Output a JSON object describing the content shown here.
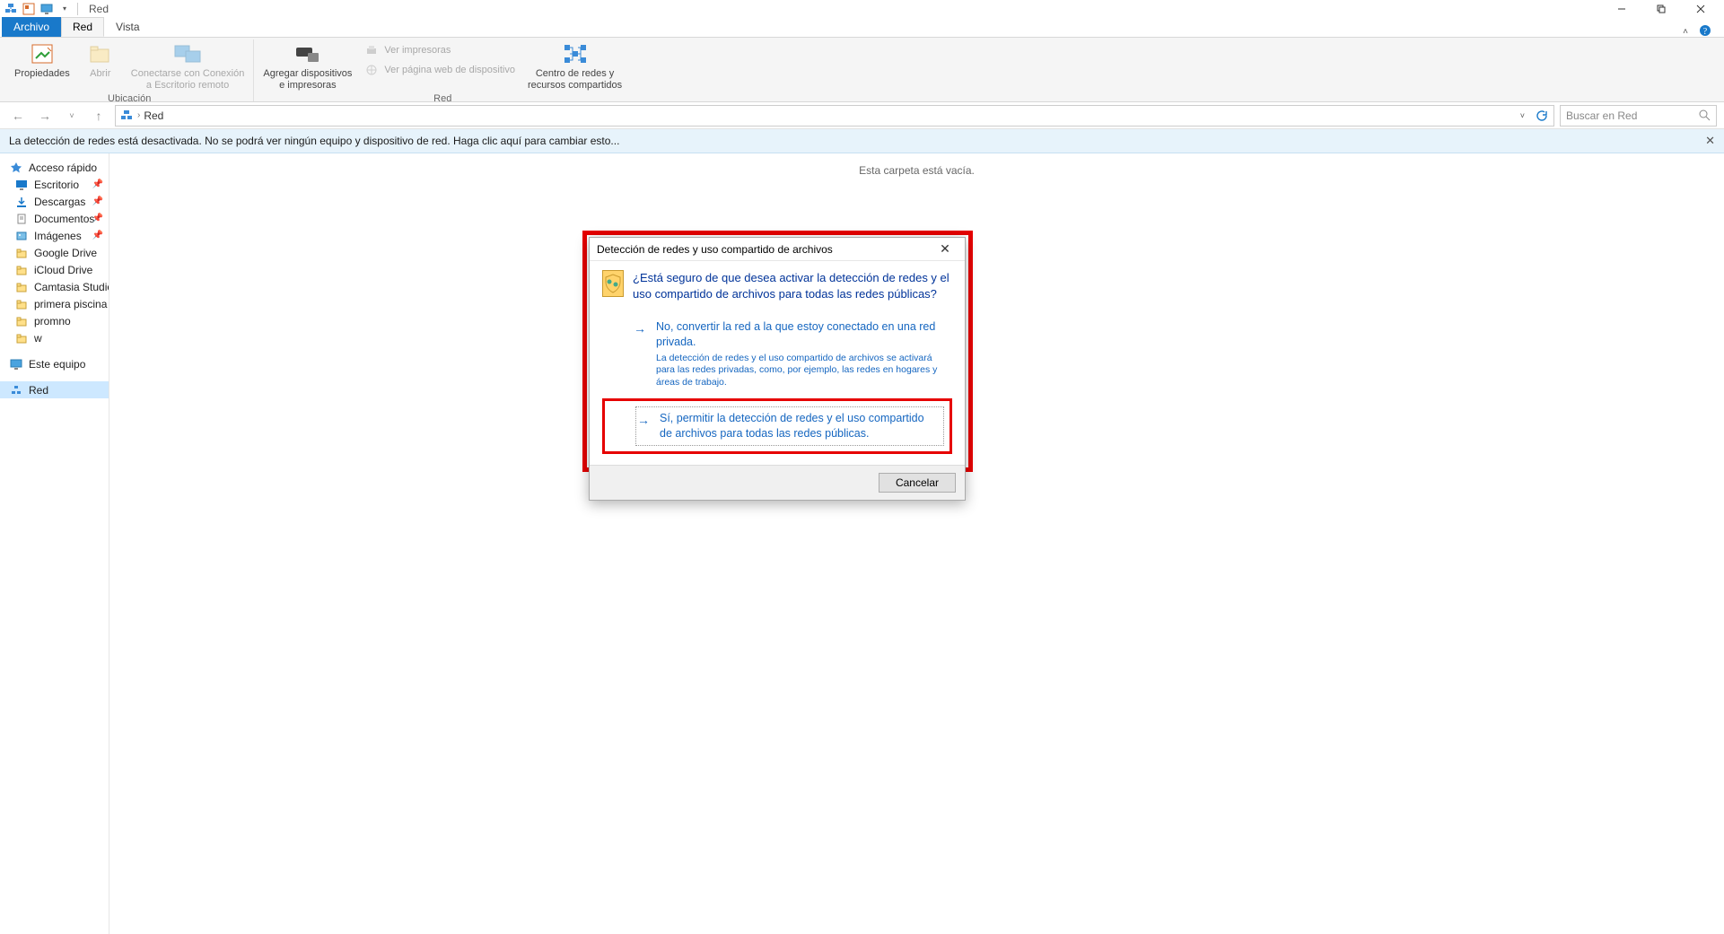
{
  "title": "Red",
  "tabs": [
    "Archivo",
    "Red",
    "Vista"
  ],
  "ribbon": {
    "ubicacion": {
      "group": "Ubicación",
      "propiedades": "Propiedades",
      "abrir": "Abrir",
      "conectarse": "Conectarse con Conexión\na Escritorio remoto"
    },
    "red": {
      "group": "Red",
      "agregar": "Agregar dispositivos\ne impresoras",
      "ver_impresoras": "Ver impresoras",
      "ver_pagina": "Ver página web de dispositivo",
      "centro": "Centro de redes y\nrecursos compartidos"
    }
  },
  "address": {
    "crumb": "Red"
  },
  "search": {
    "placeholder": "Buscar en Red"
  },
  "banner": {
    "text": "La detección de redes está desactivada. No se podrá ver ningún equipo y dispositivo de red. Haga clic aquí para cambiar esto..."
  },
  "sidebar": {
    "quick_access": "Acceso rápido",
    "items": [
      {
        "label": "Escritorio",
        "pinned": true
      },
      {
        "label": "Descargas",
        "pinned": true
      },
      {
        "label": "Documentos",
        "pinned": true
      },
      {
        "label": "Imágenes",
        "pinned": true
      },
      {
        "label": "Google Drive",
        "pinned": false
      },
      {
        "label": "iCloud Drive",
        "pinned": false
      },
      {
        "label": "Camtasia Studio",
        "pinned": false
      },
      {
        "label": "primera piscina",
        "pinned": false
      },
      {
        "label": "promno",
        "pinned": false
      },
      {
        "label": "w",
        "pinned": false
      }
    ],
    "este_equipo": "Este equipo",
    "red": "Red"
  },
  "content": {
    "empty": "Esta carpeta está vacía."
  },
  "dialog": {
    "title": "Detección de redes y uso compartido de archivos",
    "question": "¿Está seguro de que desea activar la detección de redes y el uso compartido de archivos para todas las redes públicas?",
    "options": [
      {
        "text": "No, convertir la red a la que estoy conectado en una red privada.",
        "sub": "La detección de redes y el uso compartido de archivos se activará para las redes privadas, como, por ejemplo, las redes en hogares y áreas de trabajo."
      },
      {
        "text": "Sí, permitir la detección de redes y el uso compartido de archivos para todas las redes públicas."
      }
    ],
    "cancel": "Cancelar"
  }
}
